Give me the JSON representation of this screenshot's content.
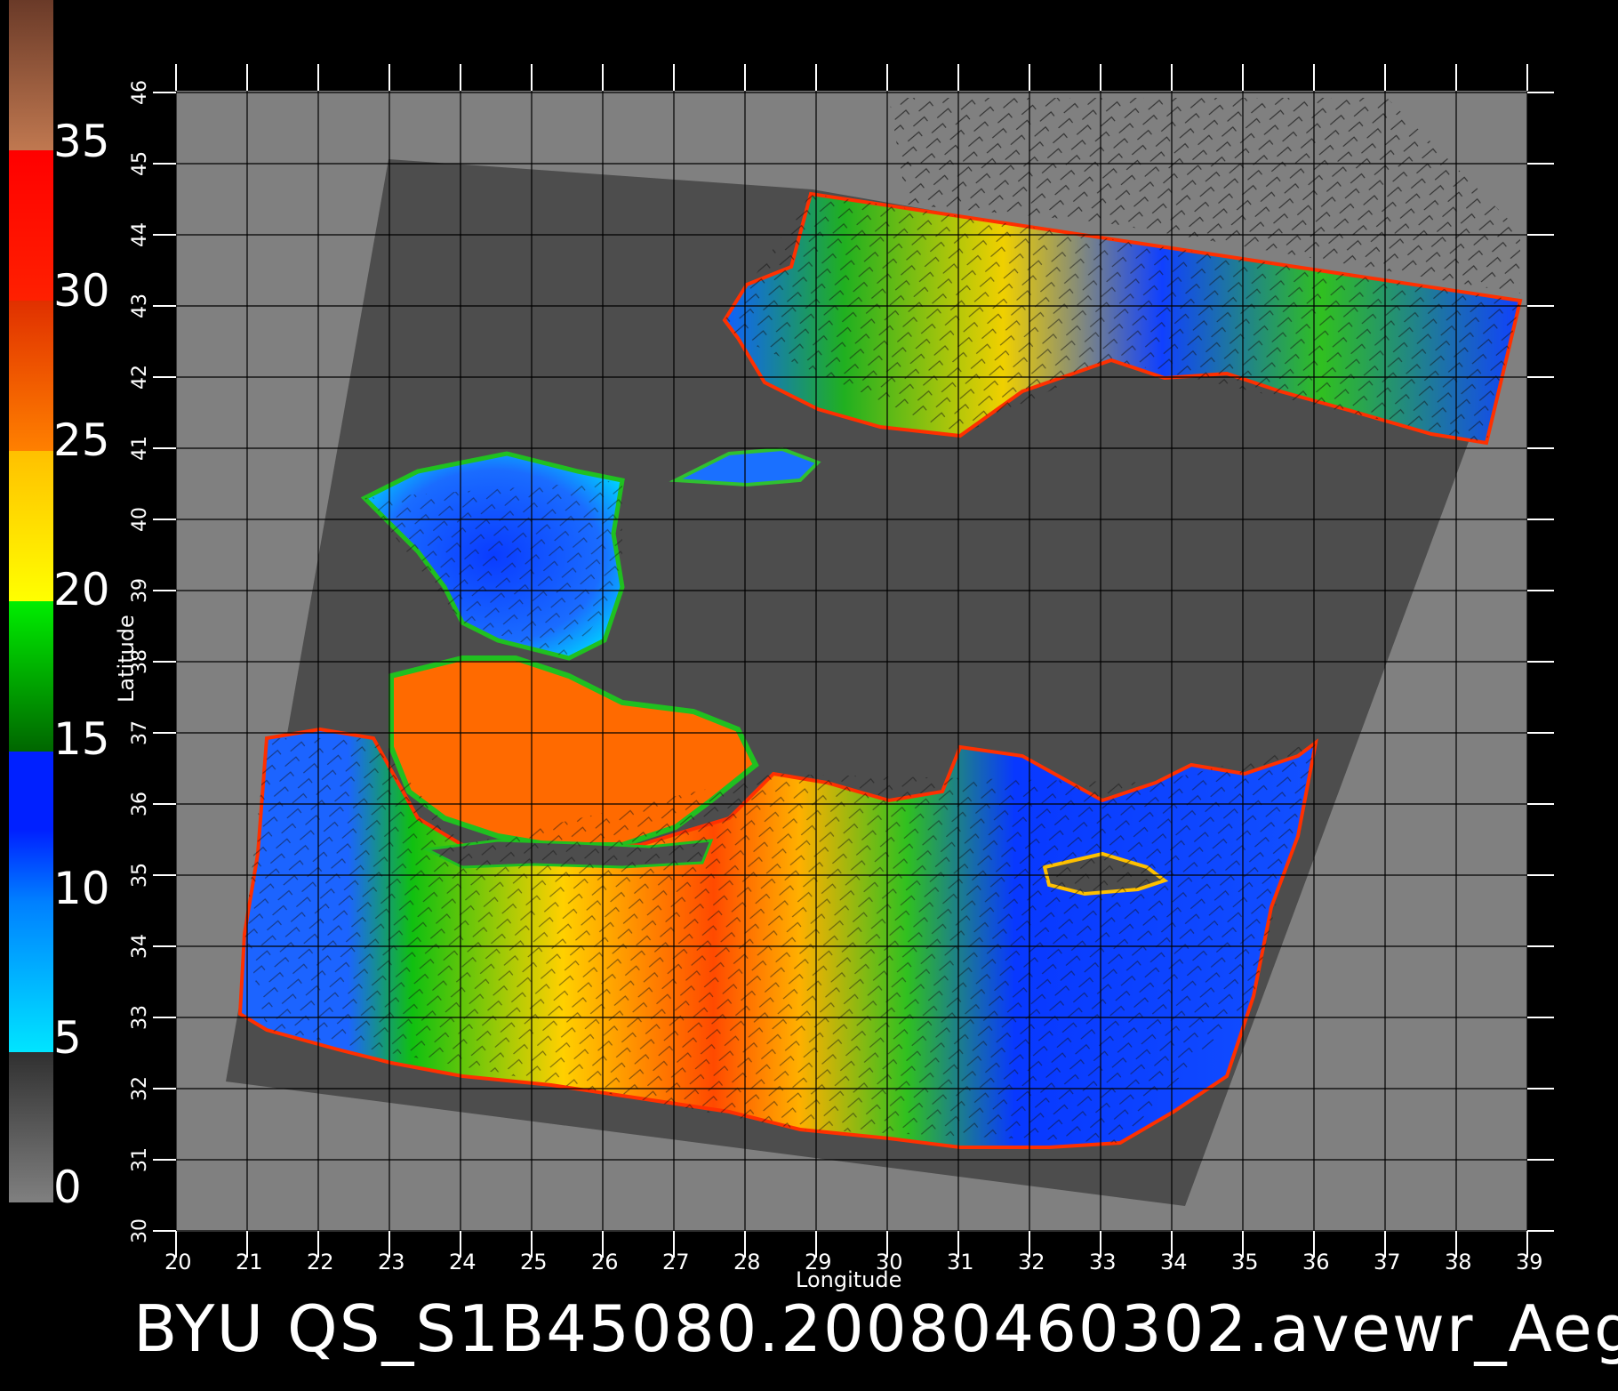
{
  "caption": "BYU QS_S1B45080.20080460302.avewr_Aeg",
  "axes": {
    "xlabel": "Longitude",
    "ylabel": "Latitude",
    "xticks": [
      "20",
      "21",
      "22",
      "23",
      "24",
      "25",
      "26",
      "27",
      "28",
      "29",
      "30",
      "31",
      "32",
      "33",
      "34",
      "35",
      "36",
      "37",
      "38",
      "39"
    ],
    "yticks": [
      "30",
      "31",
      "32",
      "33",
      "34",
      "35",
      "36",
      "37",
      "38",
      "39",
      "40",
      "41",
      "42",
      "43",
      "44",
      "45",
      "46"
    ]
  },
  "colorbar": {
    "labels": [
      "0",
      "5",
      "10",
      "15",
      "20",
      "25",
      "30",
      "35"
    ],
    "colors": {
      "grey": "#808080",
      "cyan": "#00e5ff",
      "blue": "#0030ff",
      "green": "#00cc00",
      "yellow": "#ffe600",
      "orange": "#ff7a00",
      "red": "#ff1a00",
      "brown": "#b06a40"
    }
  },
  "map": {
    "land_color": "#808080",
    "swath_color": "#4d4d4d",
    "background": "#000000"
  }
}
